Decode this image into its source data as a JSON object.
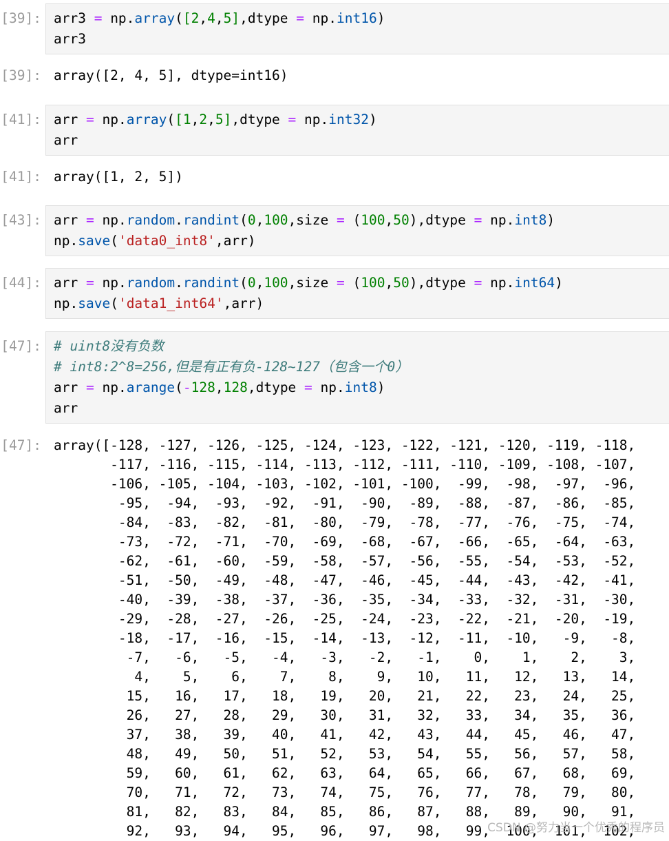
{
  "cells": [
    {
      "type": "input",
      "prompt": "[39]:",
      "lines": [
        [
          [
            "var",
            "arr3 "
          ],
          [
            "op",
            "="
          ],
          [
            "var",
            " np."
          ],
          [
            "attr",
            "array"
          ],
          [
            "var",
            "("
          ],
          [
            "num",
            "[2"
          ],
          [
            "var",
            ","
          ],
          [
            "num",
            "4"
          ],
          [
            "var",
            ","
          ],
          [
            "num",
            "5]"
          ],
          [
            "var",
            ",dtype "
          ],
          [
            "op",
            "="
          ],
          [
            "var",
            " np."
          ],
          [
            "attr",
            "int16"
          ],
          [
            "var",
            ")"
          ]
        ],
        [
          [
            "var",
            "arr3"
          ]
        ]
      ]
    },
    {
      "type": "output",
      "prompt": "[39]:",
      "lines": [
        "array([2, 4, 5], dtype=int16)"
      ]
    },
    {
      "type": "input",
      "prompt": "[41]:",
      "lines": [
        [
          [
            "var",
            "arr "
          ],
          [
            "op",
            "="
          ],
          [
            "var",
            " np."
          ],
          [
            "attr",
            "array"
          ],
          [
            "var",
            "("
          ],
          [
            "num",
            "[1"
          ],
          [
            "var",
            ","
          ],
          [
            "num",
            "2"
          ],
          [
            "var",
            ","
          ],
          [
            "num",
            "5]"
          ],
          [
            "var",
            ",dtype "
          ],
          [
            "op",
            "="
          ],
          [
            "var",
            " np."
          ],
          [
            "attr",
            "int32"
          ],
          [
            "var",
            ")"
          ]
        ],
        [
          [
            "var",
            "arr"
          ]
        ]
      ]
    },
    {
      "type": "output",
      "prompt": "[41]:",
      "lines": [
        "array([1, 2, 5])"
      ]
    },
    {
      "type": "input",
      "prompt": "[43]:",
      "lines": [
        [
          [
            "var",
            "arr "
          ],
          [
            "op",
            "="
          ],
          [
            "var",
            " np."
          ],
          [
            "attr",
            "random"
          ],
          [
            "var",
            "."
          ],
          [
            "attr",
            "randint"
          ],
          [
            "var",
            "("
          ],
          [
            "num",
            "0"
          ],
          [
            "var",
            ","
          ],
          [
            "num",
            "100"
          ],
          [
            "var",
            ",size "
          ],
          [
            "op",
            "="
          ],
          [
            "var",
            " ("
          ],
          [
            "num",
            "100"
          ],
          [
            "var",
            ","
          ],
          [
            "num",
            "50"
          ],
          [
            "var",
            "),dtype "
          ],
          [
            "op",
            "="
          ],
          [
            "var",
            " np."
          ],
          [
            "attr",
            "int8"
          ],
          [
            "var",
            ")"
          ]
        ],
        [
          [
            "var",
            "np."
          ],
          [
            "attr",
            "save"
          ],
          [
            "var",
            "("
          ],
          [
            "str",
            "'data0_int8'"
          ],
          [
            "var",
            ",arr)"
          ]
        ]
      ]
    },
    {
      "type": "input",
      "prompt": "[44]:",
      "lines": [
        [
          [
            "var",
            "arr "
          ],
          [
            "op",
            "="
          ],
          [
            "var",
            " np."
          ],
          [
            "attr",
            "random"
          ],
          [
            "var",
            "."
          ],
          [
            "attr",
            "randint"
          ],
          [
            "var",
            "("
          ],
          [
            "num",
            "0"
          ],
          [
            "var",
            ","
          ],
          [
            "num",
            "100"
          ],
          [
            "var",
            ",size "
          ],
          [
            "op",
            "="
          ],
          [
            "var",
            " ("
          ],
          [
            "num",
            "100"
          ],
          [
            "var",
            ","
          ],
          [
            "num",
            "50"
          ],
          [
            "var",
            "),dtype "
          ],
          [
            "op",
            "="
          ],
          [
            "var",
            " np."
          ],
          [
            "attr",
            "int64"
          ],
          [
            "var",
            ")"
          ]
        ],
        [
          [
            "var",
            "np."
          ],
          [
            "attr",
            "save"
          ],
          [
            "var",
            "("
          ],
          [
            "str",
            "'data1_int64'"
          ],
          [
            "var",
            ",arr)"
          ]
        ]
      ]
    },
    {
      "type": "input",
      "prompt": "[47]:",
      "lines": [
        [
          [
            "cm",
            "# uint8没有负数"
          ]
        ],
        [
          [
            "cm",
            "# int8:2^8=256,但是有正有负-128~127（包含一个0）"
          ]
        ],
        [
          [
            "var",
            "arr "
          ],
          [
            "op",
            "="
          ],
          [
            "var",
            " np."
          ],
          [
            "attr",
            "arange"
          ],
          [
            "var",
            "("
          ],
          [
            "op",
            "-"
          ],
          [
            "num",
            "128"
          ],
          [
            "var",
            ","
          ],
          [
            "num",
            "128"
          ],
          [
            "var",
            ",dtype "
          ],
          [
            "op",
            "="
          ],
          [
            "var",
            " np."
          ],
          [
            "attr",
            "int8"
          ],
          [
            "var",
            ")"
          ]
        ],
        [
          [
            "var",
            "arr"
          ]
        ]
      ]
    },
    {
      "type": "output",
      "prompt": "[47]:",
      "lines": [
        "array([-128, -127, -126, -125, -124, -123, -122, -121, -120, -119, -118,",
        "       -117, -116, -115, -114, -113, -112, -111, -110, -109, -108, -107,",
        "       -106, -105, -104, -103, -102, -101, -100,  -99,  -98,  -97,  -96,",
        "        -95,  -94,  -93,  -92,  -91,  -90,  -89,  -88,  -87,  -86,  -85,",
        "        -84,  -83,  -82,  -81,  -80,  -79,  -78,  -77,  -76,  -75,  -74,",
        "        -73,  -72,  -71,  -70,  -69,  -68,  -67,  -66,  -65,  -64,  -63,",
        "        -62,  -61,  -60,  -59,  -58,  -57,  -56,  -55,  -54,  -53,  -52,",
        "        -51,  -50,  -49,  -48,  -47,  -46,  -45,  -44,  -43,  -42,  -41,",
        "        -40,  -39,  -38,  -37,  -36,  -35,  -34,  -33,  -32,  -31,  -30,",
        "        -29,  -28,  -27,  -26,  -25,  -24,  -23,  -22,  -21,  -20,  -19,",
        "        -18,  -17,  -16,  -15,  -14,  -13,  -12,  -11,  -10,   -9,   -8,",
        "         -7,   -6,   -5,   -4,   -3,   -2,   -1,    0,    1,    2,    3,",
        "          4,    5,    6,    7,    8,    9,   10,   11,   12,   13,   14,",
        "         15,   16,   17,   18,   19,   20,   21,   22,   23,   24,   25,",
        "         26,   27,   28,   29,   30,   31,   32,   33,   34,   35,   36,",
        "         37,   38,   39,   40,   41,   42,   43,   44,   45,   46,   47,",
        "         48,   49,   50,   51,   52,   53,   54,   55,   56,   57,   58,",
        "         59,   60,   61,   62,   63,   64,   65,   66,   67,   68,   69,",
        "         70,   71,   72,   73,   74,   75,   76,   77,   78,   79,   80,",
        "         81,   82,   83,   84,   85,   86,   87,   88,   89,   90,   91,",
        "         92,   93,   94,   95,   96,   97,   98,   99,  100,  101,  102,"
      ]
    }
  ],
  "watermark": "CSDN @努力当一个优秀的程序员"
}
